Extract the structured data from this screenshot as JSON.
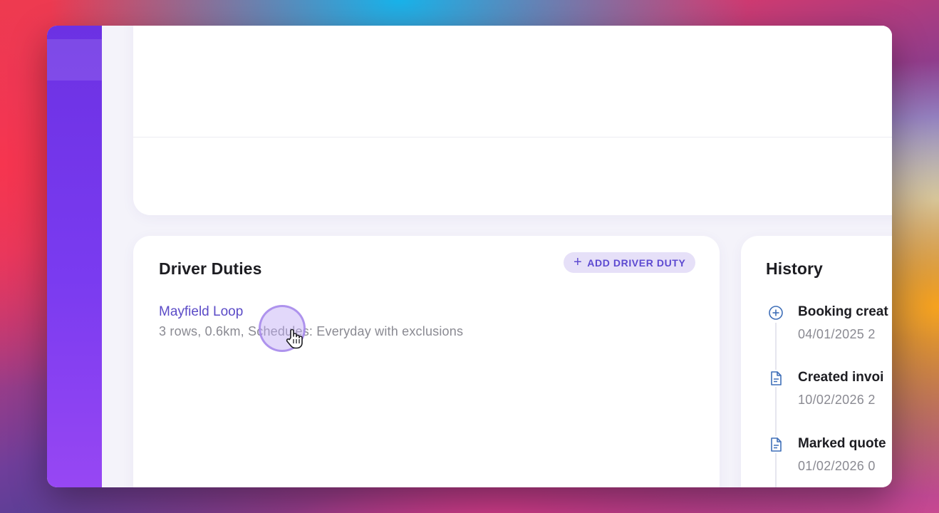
{
  "duties": {
    "title": "Driver Duties",
    "add_label": "ADD DRIVER DUTY",
    "items": [
      {
        "name": "Mayfield Loop",
        "description": "3 rows, 0.6km, Schedules: Everyday with exclusions"
      }
    ]
  },
  "history": {
    "title": "History",
    "items": [
      {
        "icon": "plus-circle-icon",
        "title": "Booking creat",
        "date": "04/01/2025 2"
      },
      {
        "icon": "document-icon",
        "title": "Created invoi",
        "date": "10/02/2026 2"
      },
      {
        "icon": "document-icon",
        "title": "Marked quote",
        "date": "01/02/2026 0"
      }
    ]
  },
  "colors": {
    "accent": "#5b4bc7",
    "sidebar": "#7a3bf0",
    "icon_blue": "#3f6fb8"
  }
}
